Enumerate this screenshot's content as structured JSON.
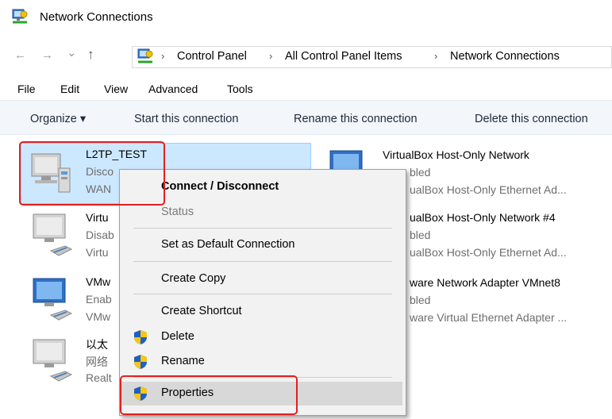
{
  "window": {
    "title": "Network Connections"
  },
  "address_bar": {
    "back_glyph": "←",
    "forward_glyph": "→",
    "dropdown_glyph": "⌄",
    "up_glyph": "↑",
    "separator": "›",
    "breadcrumbs": [
      "Control Panel",
      "All Control Panel Items",
      "Network Connections"
    ]
  },
  "menu_bar": [
    "File",
    "Edit",
    "View",
    "Advanced",
    "Tools"
  ],
  "command_bar": {
    "organize": "Organize ▾",
    "start": "Start this connection",
    "rename": "Rename this connection",
    "delete": "Delete this connection"
  },
  "connections_left": [
    {
      "name": "L2TP_TEST",
      "line1": "Disco",
      "line2": "WAN"
    },
    {
      "name": "Virtu",
      "line1": "Disab",
      "line2": "Virtu"
    },
    {
      "name": "VMw",
      "line1": "Enab",
      "line2": "VMw"
    },
    {
      "name": "以太",
      "line1": "网络",
      "line2": "Realt"
    }
  ],
  "connections_right": [
    {
      "name": "VirtualBox Host-Only Network",
      "line1": "bled",
      "line2": "ualBox Host-Only Ethernet Ad..."
    },
    {
      "name": "ualBox Host-Only Network #4",
      "line1": "bled",
      "line2": "ualBox Host-Only Ethernet Ad..."
    },
    {
      "name": "ware Network Adapter VMnet8",
      "line1": "bled",
      "line2": "ware Virtual Ethernet Adapter ..."
    }
  ],
  "context_menu": {
    "connect_disconnect": "Connect / Disconnect",
    "status": "Status",
    "set_default": "Set as Default Connection",
    "create_copy": "Create Copy",
    "create_shortcut": "Create Shortcut",
    "delete": "Delete",
    "rename": "Rename",
    "properties": "Properties"
  },
  "colors": {
    "highlight_red": "#e51e1e",
    "selection_blue": "#cce8ff",
    "shield_blue": "#1f5fbf",
    "shield_yellow": "#f5c518"
  }
}
